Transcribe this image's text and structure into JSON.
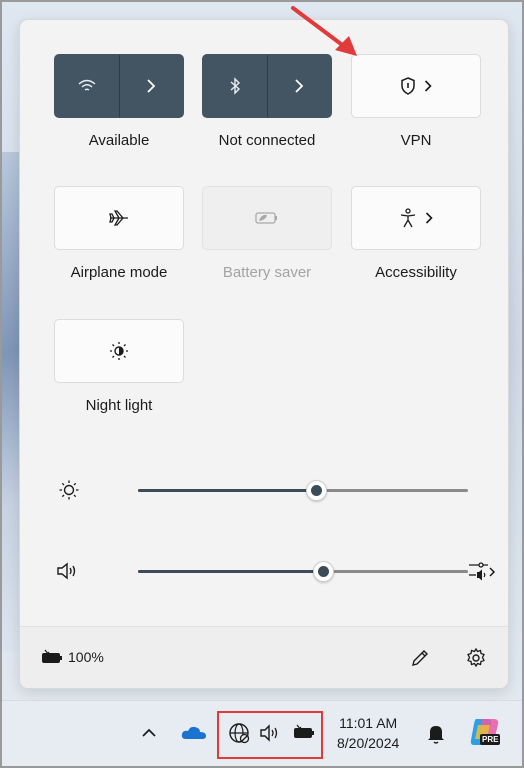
{
  "quick_settings": {
    "tiles": [
      {
        "id": "wifi",
        "label": "Available",
        "icon": "wifi-icon",
        "state": "on",
        "split": true
      },
      {
        "id": "bluetooth",
        "label": "Not connected",
        "icon": "bluetooth-icon",
        "state": "on",
        "split": true
      },
      {
        "id": "vpn",
        "label": "VPN",
        "icon": "shield-icon",
        "state": "off",
        "chevron": true
      },
      {
        "id": "airplane",
        "label": "Airplane mode",
        "icon": "airplane-icon",
        "state": "off"
      },
      {
        "id": "battery_saver",
        "label": "Battery saver",
        "icon": "battery-saver-icon",
        "state": "disabled"
      },
      {
        "id": "accessibility",
        "label": "Accessibility",
        "icon": "accessibility-icon",
        "state": "off",
        "chevron": true
      },
      {
        "id": "night_light",
        "label": "Night light",
        "icon": "night-light-icon",
        "state": "off"
      }
    ],
    "sliders": {
      "brightness": {
        "icon": "brightness-icon",
        "value": 0.54
      },
      "volume": {
        "icon": "speaker-icon",
        "value": 0.56,
        "output_icon": "sound-output-icon"
      }
    },
    "footer": {
      "battery_percent": "100%",
      "battery_icon": "battery-charging-icon",
      "edit_icon": "pencil-icon",
      "settings_icon": "gear-icon"
    }
  },
  "taskbar": {
    "clock_time": "11:01 AM",
    "clock_date": "8/20/2024",
    "tray_icons": [
      "chevron-up-icon",
      "onedrive-icon",
      "network-globe-icon",
      "speaker-icon",
      "battery-charging-icon"
    ],
    "copilot_badge": "PRE"
  },
  "colors": {
    "tile_on": "#435463",
    "annotation_red": "#e03a3a",
    "slider_fill": "#3a4b5a"
  }
}
